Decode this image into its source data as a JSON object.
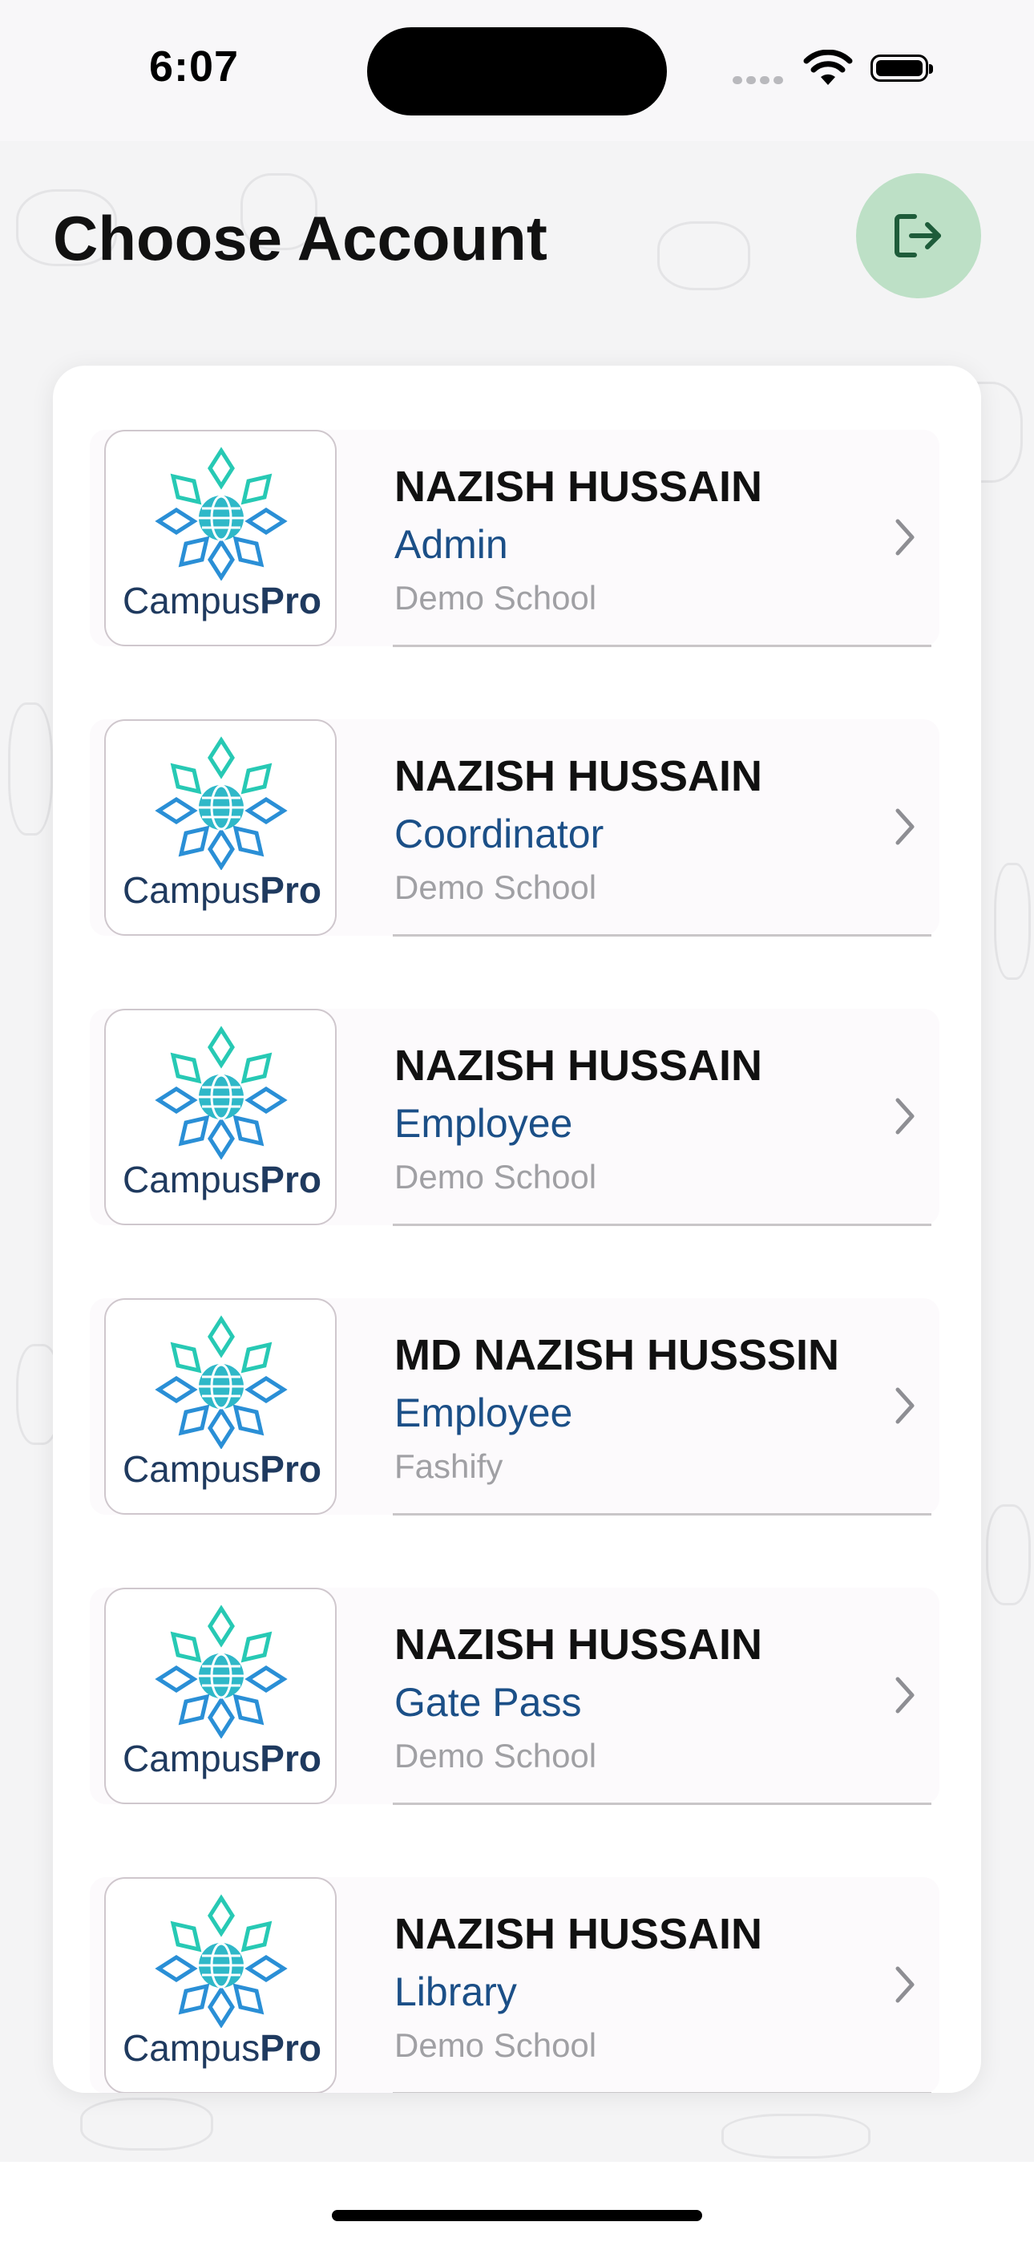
{
  "status_bar": {
    "time": "6:07"
  },
  "header": {
    "title": "Choose Account"
  },
  "logo": {
    "prefix": "Campus",
    "suffix": "Pro"
  },
  "accounts": [
    {
      "name": "NAZISH HUSSAIN",
      "role": "Admin",
      "school": "Demo School"
    },
    {
      "name": "NAZISH HUSSAIN",
      "role": "Coordinator",
      "school": "Demo School"
    },
    {
      "name": "NAZISH HUSSAIN",
      "role": "Employee",
      "school": "Demo School"
    },
    {
      "name": "MD NAZISH HUSSSIN",
      "role": "Employee",
      "school": "Fashify"
    },
    {
      "name": "NAZISH HUSSAIN",
      "role": "Gate Pass",
      "school": "Demo School"
    },
    {
      "name": "NAZISH HUSSAIN",
      "role": "Library",
      "school": "Demo School"
    }
  ],
  "colors": {
    "accent": "#1b4f87",
    "logout_bg": "#bde0c6",
    "logout_icon": "#1e5c3a"
  },
  "icons": {
    "logout": "logout-icon",
    "chevron": "chevron-right-icon",
    "wifi": "wifi-icon",
    "battery": "battery-icon"
  }
}
